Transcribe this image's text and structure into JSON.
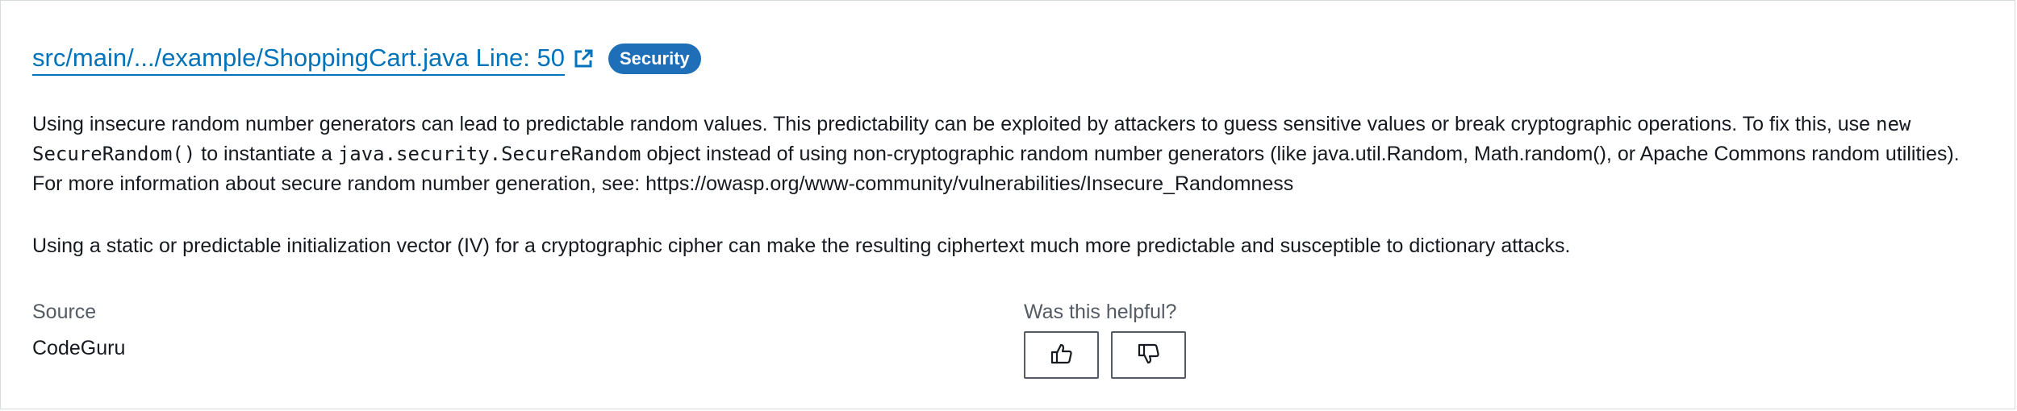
{
  "finding": {
    "file_link_text": "src/main/.../example/ShoppingCart.java Line: 50",
    "external_link_icon": "external-link-icon",
    "badge": "Security"
  },
  "description": {
    "p1_part1": "Using insecure random number generators can lead to predictable random values. This predictability can be exploited by attackers to guess sensitive values or break cryptographic operations. To fix this, use ",
    "p1_code1": "new SecureRandom()",
    "p1_part2": " to instantiate a ",
    "p1_code2": "java.security.SecureRandom",
    "p1_part3": " object instead of using non-cryptographic random number generators (like java.util.Random, Math.random(), or Apache Commons random utilities). For more information about secure random number generation, see: https://owasp.org/www-community/vulnerabilities/Insecure_Randomness",
    "p2": "Using a static or predictable initialization vector (IV) for a cryptographic cipher can make the resulting ciphertext much more predictable and susceptible to dictionary attacks."
  },
  "source": {
    "label": "Source",
    "value": "CodeGuru"
  },
  "feedback": {
    "label": "Was this helpful?",
    "thumbs_up_icon": "thumbs-up-icon",
    "thumbs_down_icon": "thumbs-down-icon"
  },
  "colors": {
    "link": "#0073bb",
    "badge_bg": "#1f6fb8",
    "text": "#16191f",
    "muted": "#545b64"
  }
}
